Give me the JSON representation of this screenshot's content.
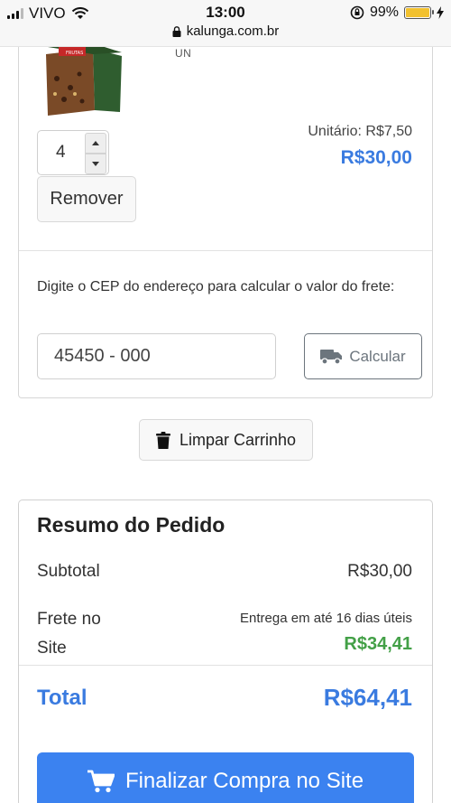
{
  "status_bar": {
    "carrier": "VIVO",
    "time": "13:00",
    "battery": "99%",
    "url": "kalunga.com.br",
    "battery_color": "#f2c12e"
  },
  "cart_item": {
    "unit": "UN",
    "quantity": "4",
    "remove_label": "Remover",
    "unit_price": "Unitário: R$7,50",
    "line_total": "R$30,00"
  },
  "shipping": {
    "instruction": "Digite o CEP do endereço para calcular o valor do frete:",
    "cep_value": "45450 - 000",
    "calculate_label": "Calcular"
  },
  "clear_cart_label": "Limpar Carrinho",
  "summary": {
    "title": "Resumo do Pedido",
    "subtotal_label": "Subtotal",
    "subtotal_value": "R$30,00",
    "frete_label_line1": "Frete no",
    "frete_label_line2": "Site",
    "delivery_text": "Entrega em até 16 dias úteis",
    "frete_value": "R$34,41",
    "total_label": "Total",
    "total_value": "R$64,41",
    "checkout_label": "Finalizar Compra no Site"
  },
  "colors": {
    "accent_blue": "#3a7be0",
    "checkout_blue": "#3b82f0",
    "shipping_green": "#43a047"
  }
}
